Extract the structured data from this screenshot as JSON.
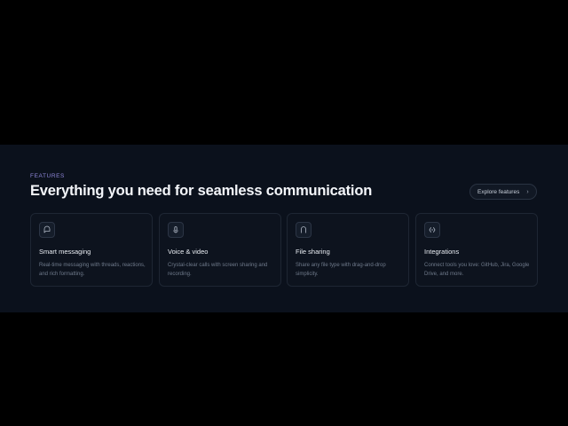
{
  "features": {
    "eyebrow": "FEATURES",
    "heading": "Everything you need for seamless communication",
    "explore_button": {
      "label": "Explore features",
      "icon": "chevron-right-icon"
    },
    "cards": [
      {
        "icon": "message-bubble-icon",
        "title": "Smart messaging",
        "description": "Real-time messaging with threads, reactions, and rich formatting."
      },
      {
        "icon": "microphone-icon",
        "title": "Voice & video",
        "description": "Crystal-clear calls with screen sharing and recording."
      },
      {
        "icon": "file-icon",
        "title": "File sharing",
        "description": "Share any file type with drag-and-drop simplicity."
      },
      {
        "icon": "integration-icon",
        "title": "Integrations",
        "description": "Connect tools you love: GitHub, Jira, Google Drive, and more."
      }
    ]
  },
  "colors": {
    "page_background": "#000000",
    "section_background": "#0b111c",
    "card_background": "#0d131e",
    "card_border": "#1e2633",
    "eyebrow": "#8f86d9",
    "heading": "#f4f6fa",
    "body_text": "#6f7a8b"
  }
}
